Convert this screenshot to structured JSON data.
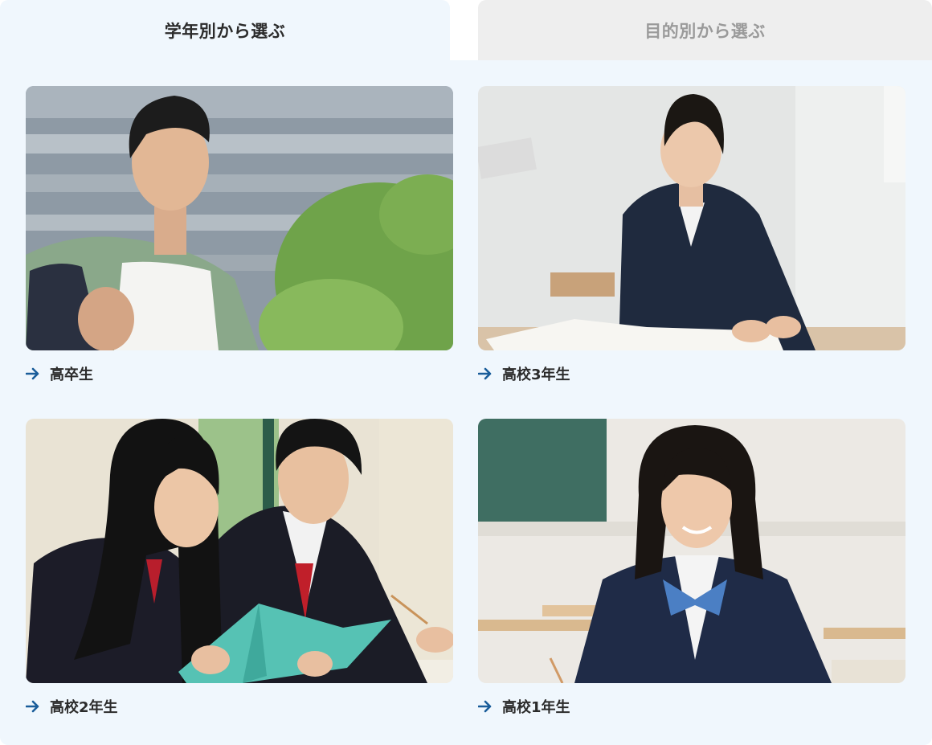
{
  "tabs": [
    {
      "label": "学年別から選ぶ",
      "active": true
    },
    {
      "label": "目的別から選ぶ",
      "active": false
    }
  ],
  "cards": [
    {
      "label": "高卒生",
      "photo": "young man outdoors in front of building with green trees"
    },
    {
      "label": "高校3年生",
      "photo": "female student in navy blazer writing in notebook at desk"
    },
    {
      "label": "高校2年生",
      "photo": "female and male students in blazers reading a teal book together"
    },
    {
      "label": "高校1年生",
      "photo": "smiling female student with blue bow in classroom"
    }
  ],
  "colors": {
    "accent": "#1a5d9a",
    "panel": "#f0f7fd",
    "inactive_tab": "#eeeeee"
  }
}
